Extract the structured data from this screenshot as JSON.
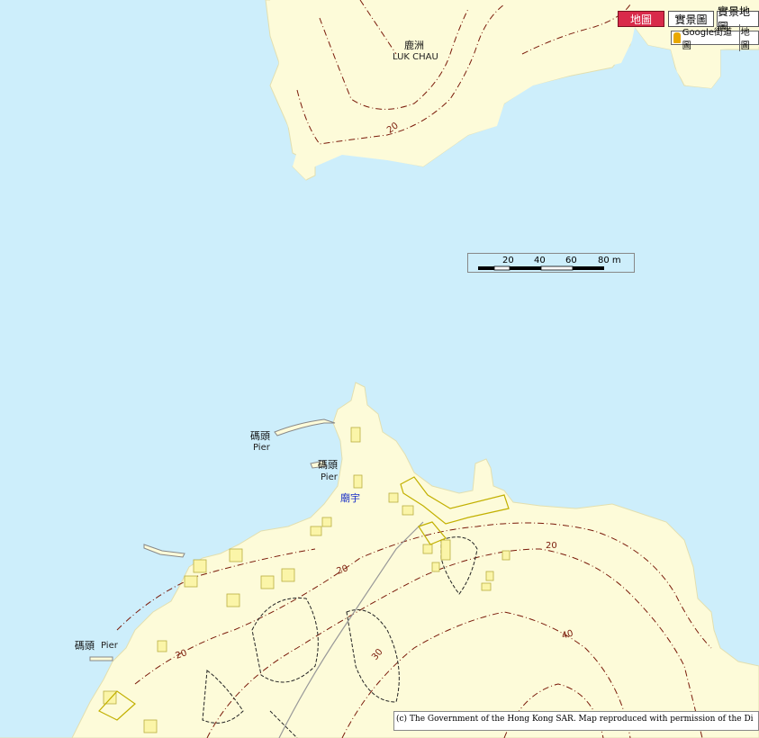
{
  "map_type_buttons": [
    {
      "label": "地圖",
      "active": true
    },
    {
      "label": "實景圖",
      "active": false
    },
    {
      "label": "實景地圖",
      "active": false
    }
  ],
  "streetview_button": {
    "label": "Google街道圖",
    "extra": "地圖"
  },
  "place_labels": {
    "luk_chau_zh": "鹿洲",
    "luk_chau_en": "LUK CHAU",
    "pier1_zh": "碼頭",
    "pier1_en": "Pier",
    "pier2_zh": "碼頭",
    "pier2_en": "Pier",
    "pier3_zh": "碼頭",
    "pier3_en": "Pier",
    "temple_zh": "廟宇"
  },
  "contour_labels": [
    "20",
    "20",
    "20",
    "20",
    "30",
    "40"
  ],
  "scale_bar": {
    "ticks": [
      "20",
      "40",
      "60",
      "80 m"
    ]
  },
  "copyright": "(c) The Government of the Hong Kong SAR. Map reproduced with permission of the Di",
  "colors": {
    "water": "#cdeefb",
    "land": "#fdfbd9",
    "contour": "#7a1a0a",
    "active_button": "#d92a4a"
  }
}
